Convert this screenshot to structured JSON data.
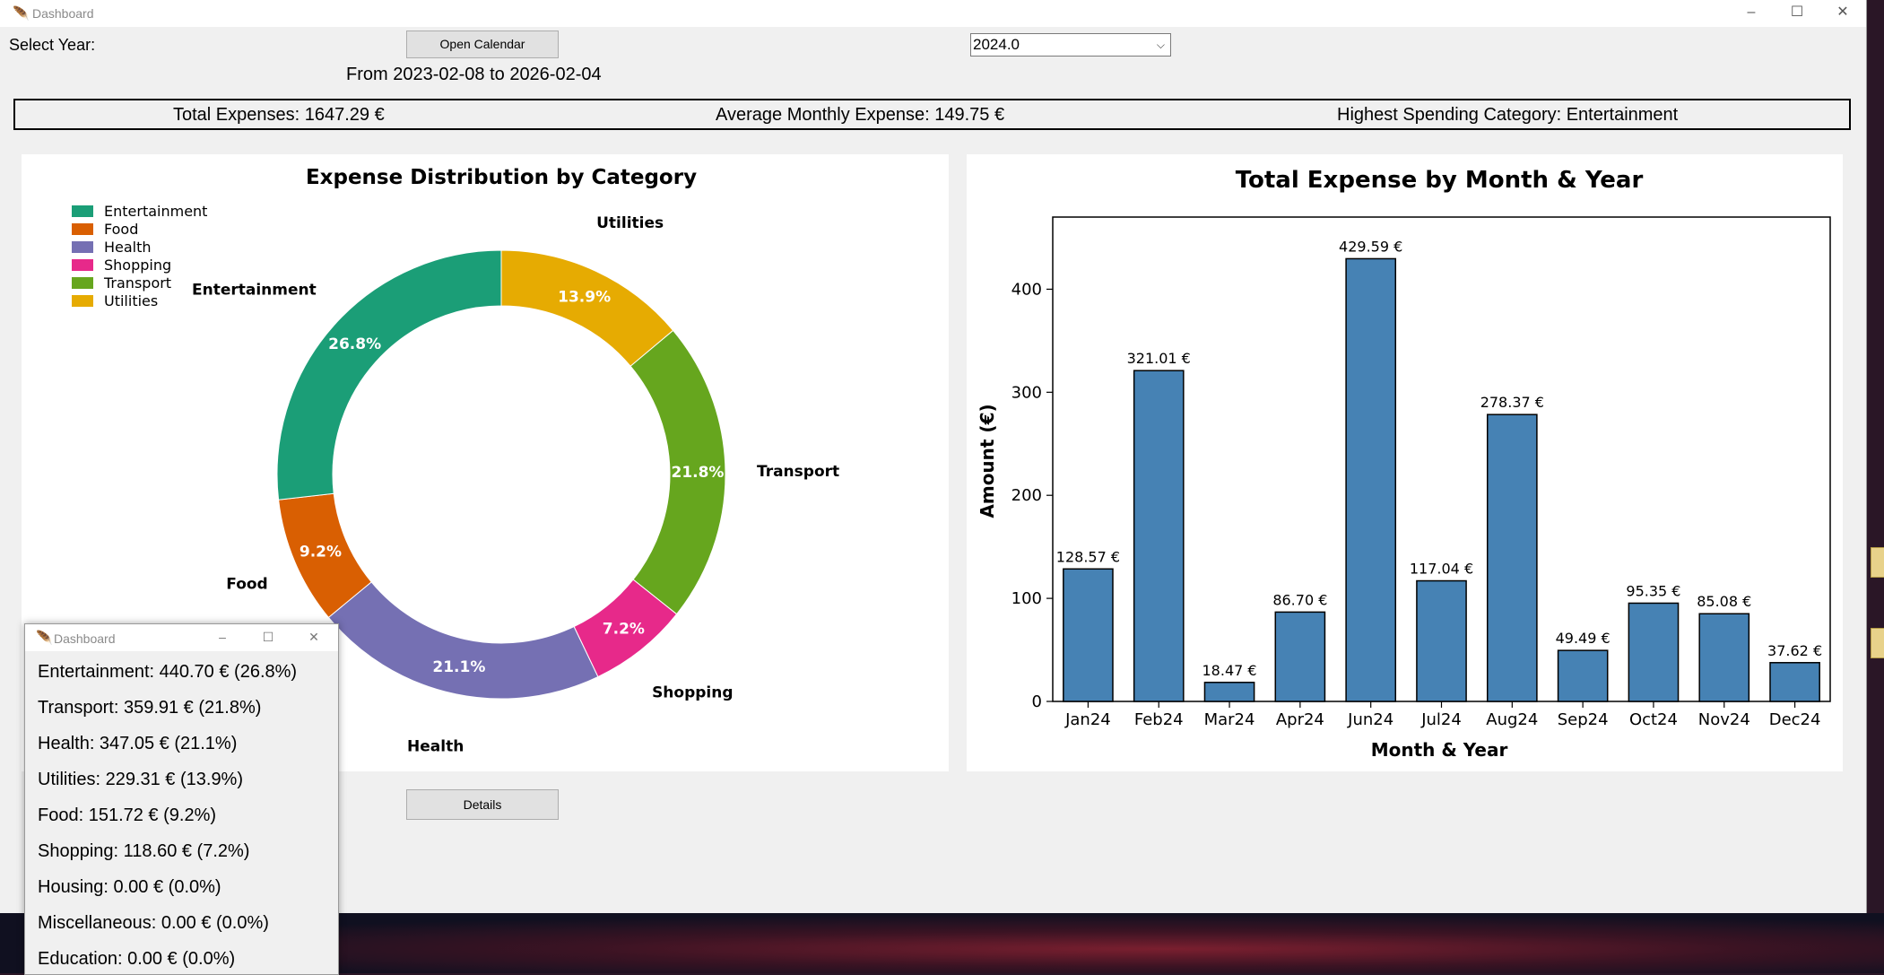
{
  "window": {
    "title": "Dashboard",
    "icon": "feather-icon",
    "controls": {
      "minimize": "–",
      "maximize": "☐",
      "close": "✕"
    }
  },
  "controls": {
    "select_year_label": "Select Year:",
    "open_calendar_label": "Open Calendar",
    "year_value": "2024.0",
    "date_range": "From 2023-02-08 to 2026-02-04",
    "details_label": "Details"
  },
  "summary": {
    "total": "Total Expenses: 1647.29 €",
    "average": "Average Monthly Expense: 149.75 €",
    "highest": "Highest Spending Category: Entertainment"
  },
  "popup": {
    "title": "Dashboard",
    "lines": [
      "Entertainment: 440.70 € (26.8%)",
      "Transport: 359.91 € (21.8%)",
      "Health: 347.05 € (21.1%)",
      "Utilities: 229.31 € (13.9%)",
      "Food: 151.72 € (9.2%)",
      "Shopping: 118.60 € (7.2%)",
      "Housing: 0.00 € (0.0%)",
      "Miscellaneous: 0.00 € (0.0%)",
      "Education: 0.00 € (0.0%)"
    ]
  },
  "chart_data": [
    {
      "type": "pie",
      "donut": true,
      "title": "Expense Distribution by Category",
      "legend_placement": "top-left",
      "legend": [
        "Entertainment",
        "Food",
        "Health",
        "Shopping",
        "Transport",
        "Utilities"
      ],
      "slices": [
        {
          "label": "Utilities",
          "value": 13.9,
          "pct_label": "13.9%",
          "color": "#e6ab02"
        },
        {
          "label": "Transport",
          "value": 21.8,
          "pct_label": "21.8%",
          "color": "#66a61e"
        },
        {
          "label": "Shopping",
          "value": 7.2,
          "pct_label": "7.2%",
          "color": "#e7298a"
        },
        {
          "label": "Health",
          "value": 21.1,
          "pct_label": "21.1%",
          "color": "#7570b3"
        },
        {
          "label": "Food",
          "value": 9.2,
          "pct_label": "9.2%",
          "color": "#d95f02"
        },
        {
          "label": "Entertainment",
          "value": 26.8,
          "pct_label": "26.8%",
          "color": "#1b9e77"
        }
      ]
    },
    {
      "type": "bar",
      "title": "Total Expense by Month & Year",
      "xlabel": "Month & Year",
      "ylabel": "Amount (€)",
      "ylim": [
        0,
        470
      ],
      "yticks": [
        0,
        100,
        200,
        300,
        400
      ],
      "color": "#4682b4",
      "categories": [
        "Jan24",
        "Feb24",
        "Mar24",
        "Apr24",
        "Jun24",
        "Jul24",
        "Aug24",
        "Sep24",
        "Oct24",
        "Nov24",
        "Dec24"
      ],
      "values": [
        128.57,
        321.01,
        18.47,
        86.7,
        429.59,
        117.04,
        278.37,
        49.49,
        95.35,
        85.08,
        37.62
      ],
      "value_labels": [
        "128.57 €",
        "321.01 €",
        "18.47 €",
        "86.70 €",
        "429.59 €",
        "117.04 €",
        "278.37 €",
        "49.49 €",
        "95.35 €",
        "85.08 €",
        "37.62 €"
      ]
    }
  ]
}
